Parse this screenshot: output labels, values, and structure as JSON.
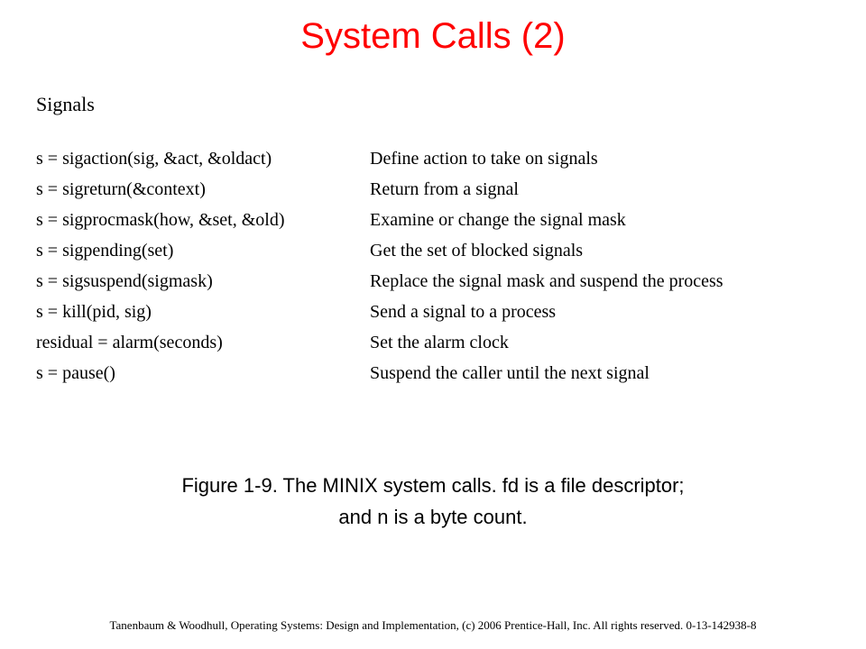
{
  "title": "System Calls (2)",
  "section": "Signals",
  "syscalls": [
    {
      "call": "s = sigaction(sig, &act, &oldact)",
      "desc": "Define action to take on signals"
    },
    {
      "call": "s = sigreturn(&context)",
      "desc": "Return from a signal"
    },
    {
      "call": "s = sigprocmask(how, &set, &old)",
      "desc": "Examine or change the signal mask"
    },
    {
      "call": "s = sigpending(set)",
      "desc": "Get the set of blocked signals"
    },
    {
      "call": "s = sigsuspend(sigmask)",
      "desc": "Replace the signal mask and suspend the process"
    },
    {
      "call": "s = kill(pid, sig)",
      "desc": "Send a signal to a process"
    },
    {
      "call": "residual = alarm(seconds)",
      "desc": "Set the alarm clock"
    },
    {
      "call": "s = pause()",
      "desc": "Suspend the caller until the next signal"
    }
  ],
  "caption_line1": "Figure 1-9. The MINIX system calls. fd is a file descriptor;",
  "caption_line2": "and n is a byte count.",
  "footer": "Tanenbaum & Woodhull, Operating Systems: Design and Implementation, (c) 2006 Prentice-Hall, Inc. All rights reserved. 0-13-142938-8"
}
